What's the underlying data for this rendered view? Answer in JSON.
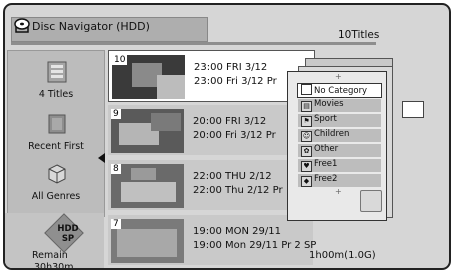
{
  "header": {
    "title": "Disc Navigator (HDD)",
    "count": "10Titles"
  },
  "sidebar": {
    "items": [
      {
        "label": "4 Titles",
        "icon": "list-icon"
      },
      {
        "label": "Recent First",
        "icon": "folder-icon"
      },
      {
        "label": "All Genres",
        "icon": "box-icon"
      }
    ],
    "badge": {
      "line1": "HDD",
      "line2": "SP"
    },
    "remain_label": "Remain",
    "remain_value": "30h30m"
  },
  "titles": [
    {
      "num": "10",
      "line1": "23:00 FRI 3/12",
      "line2": "23:00 Fri 3/12 Pr",
      "selected": true
    },
    {
      "num": "9",
      "line1": "20:00 FRI 3/12",
      "line2": "20:00 Fri 3/12 Pr",
      "selected": false
    },
    {
      "num": "8",
      "line1": "22:00 THU 2/12",
      "line2": "22:00 Thu 2/12 Pr",
      "selected": false
    },
    {
      "num": "7",
      "line1": "19:00 MON 29/11",
      "line2": "19:00 Mon 29/11 Pr 2 SP",
      "duration": "1h00m(1.0G)",
      "selected": false
    }
  ],
  "genre_popup": {
    "items": [
      {
        "label": "No Category",
        "active": true
      },
      {
        "label": "Movies",
        "active": false
      },
      {
        "label": "Sport",
        "active": false
      },
      {
        "label": "Children",
        "active": false
      },
      {
        "label": "Other",
        "active": false
      },
      {
        "label": "Free1",
        "active": false
      },
      {
        "label": "Free2",
        "active": false
      }
    ]
  }
}
